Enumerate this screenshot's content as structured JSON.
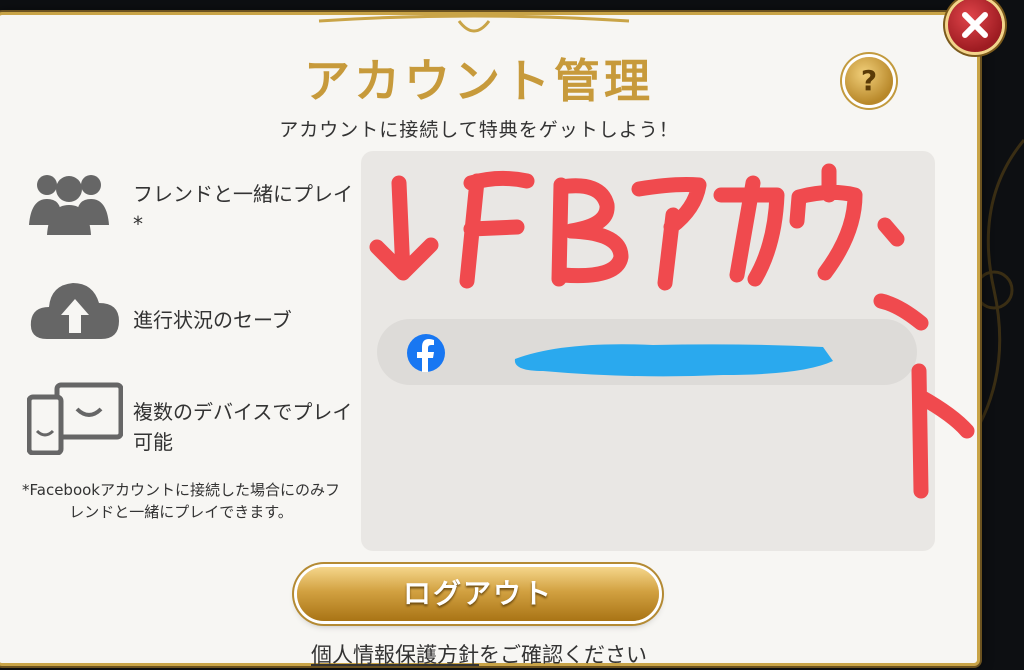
{
  "dialog": {
    "title": "アカウント管理",
    "subtitle": "アカウントに接続して特典をゲットしよう！",
    "help_label": "?",
    "close_icon": "close-icon"
  },
  "features": [
    {
      "icon": "friends-icon",
      "label": "フレンドと一緒にプレイ*"
    },
    {
      "icon": "cloud-upload-icon",
      "label": "進行状況のセーブ"
    },
    {
      "icon": "devices-icon",
      "label": "複数のデバイスでプレイ可能"
    }
  ],
  "footnote": "*Facebookアカウントに接続した場合にのみフレンドと一緒にプレイできます。",
  "account": {
    "provider_icon": "facebook-icon",
    "name_redacted": true
  },
  "annotation": {
    "text": "↓FBアカウント",
    "color": "#f04a4e"
  },
  "buttons": {
    "logout_label": "ログアウト"
  },
  "privacy": {
    "link_text": "個人情報保護方針",
    "suffix_text": "をご確認ください"
  },
  "colors": {
    "gold": "#c79a3b",
    "facebook_blue": "#1877f2",
    "redaction_blue": "#2aa9ee"
  }
}
